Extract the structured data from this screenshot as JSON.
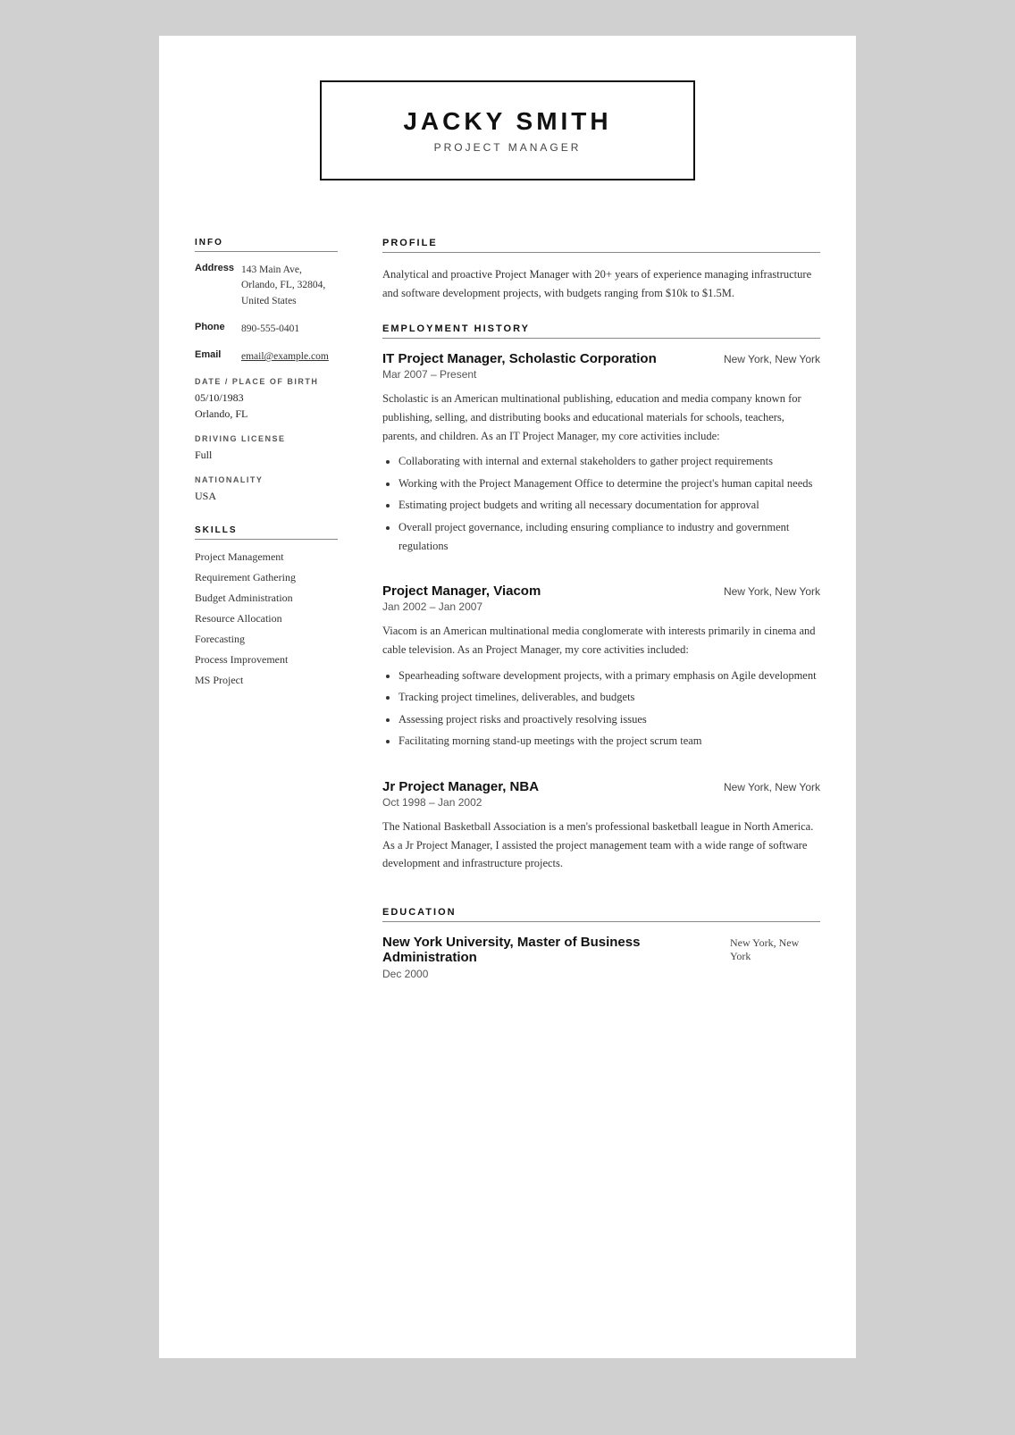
{
  "header": {
    "name": "JACKY SMITH",
    "title": "PROJECT MANAGER"
  },
  "left": {
    "info_section_title": "INFO",
    "address_label": "Address",
    "address_value": "143 Main Ave,\nOrlando, FL, 32804,\nUnited States",
    "phone_label": "Phone",
    "phone_value": "890-555-0401",
    "email_label": "Email",
    "email_value": "email@example.com",
    "dob_label": "DATE / PLACE OF BIRTH",
    "dob_value": "05/10/1983\nOrlando, FL",
    "license_label": "DRIVING LICENSE",
    "license_value": "Full",
    "nationality_label": "NATIONALITY",
    "nationality_value": "USA",
    "skills_section_title": "SKILLS",
    "skills": [
      "Project Management",
      "Requirement Gathering",
      "Budget Administration",
      "Resource Allocation",
      "Forecasting",
      "Process Improvement",
      "MS Project"
    ]
  },
  "right": {
    "profile_section_title": "PROFILE",
    "profile_text": "Analytical and proactive Project Manager with 20+ years of experience managing infrastructure and software development projects, with budgets ranging from $10k to $1.5M.",
    "employment_section_title": "EMPLOYMENT HISTORY",
    "jobs": [
      {
        "title": "IT Project Manager, Scholastic Corporation",
        "location": "New York, New York",
        "dates": "Mar 2007 – Present",
        "description": "Scholastic is an American multinational publishing, education and media company known for publishing, selling, and distributing books and educational materials for schools, teachers, parents, and children. As an IT Project Manager, my core activities include:",
        "bullets": [
          "Collaborating with internal and external stakeholders to gather project requirements",
          "Working with the Project Management Office to determine the project's human capital needs",
          "Estimating project budgets and writing all necessary documentation for approval",
          "Overall project governance, including ensuring compliance to industry and government regulations"
        ]
      },
      {
        "title": "Project Manager, Viacom",
        "location": "New York, New York",
        "dates": "Jan 2002 – Jan 2007",
        "description": "Viacom is an American multinational media conglomerate with interests primarily in cinema and cable television. As an Project Manager, my core activities included:",
        "bullets": [
          "Spearheading software development projects, with a primary emphasis on Agile development",
          "Tracking project timelines, deliverables, and budgets",
          "Assessing project risks and proactively resolving issues",
          "Facilitating morning stand-up meetings with the project scrum team"
        ]
      },
      {
        "title": "Jr Project Manager, NBA",
        "location": "New York, New York",
        "dates": "Oct 1998 – Jan 2002",
        "description": "The National Basketball Association is a men's professional basketball league in North America. As a Jr Project Manager, I assisted the project management team with a wide range of software development and infrastructure projects.",
        "bullets": []
      }
    ],
    "education_section_title": "EDUCATION",
    "education": [
      {
        "title": "New York University, Master of Business Administration",
        "location": "New York, New York",
        "dates": "Dec 2000"
      }
    ]
  }
}
